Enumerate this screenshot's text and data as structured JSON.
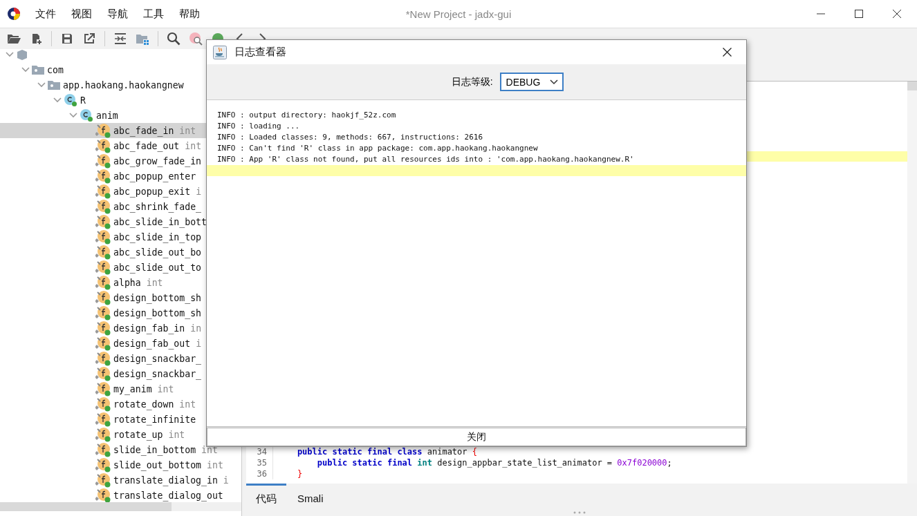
{
  "window": {
    "title": "*New Project - jadx-gui"
  },
  "menu": [
    "文件",
    "视图",
    "导航",
    "工具",
    "帮助"
  ],
  "tree": [
    {
      "kind": "root",
      "expanded": true,
      "selected": false,
      "children": [
        {
          "kind": "package",
          "name": "com",
          "expanded": true,
          "selected": false,
          "children": [
            {
              "kind": "package",
              "name": "app.haokang.haokangnew",
              "expanded": true,
              "selected": false,
              "children": [
                {
                  "kind": "class",
                  "name": "R",
                  "expanded": true,
                  "selected": false,
                  "children": [
                    {
                      "kind": "class",
                      "name": "anim",
                      "expanded": true,
                      "selected": false,
                      "children": [
                        {
                          "kind": "field",
                          "name": "abc_fade_in",
                          "type": "int",
                          "selected": true
                        },
                        {
                          "kind": "field",
                          "name": "abc_fade_out",
                          "type": "int",
                          "selected": false
                        },
                        {
                          "kind": "field",
                          "name": "abc_grow_fade_in",
                          "selected": false
                        },
                        {
                          "kind": "field",
                          "name": "abc_popup_enter",
                          "selected": false
                        },
                        {
                          "kind": "field",
                          "name": "abc_popup_exit",
                          "type": "i",
                          "selected": false
                        },
                        {
                          "kind": "field",
                          "name": "abc_shrink_fade_",
                          "selected": false
                        },
                        {
                          "kind": "field",
                          "name": "abc_slide_in_bott",
                          "selected": false
                        },
                        {
                          "kind": "field",
                          "name": "abc_slide_in_top",
                          "selected": false
                        },
                        {
                          "kind": "field",
                          "name": "abc_slide_out_bo",
                          "selected": false
                        },
                        {
                          "kind": "field",
                          "name": "abc_slide_out_to",
                          "selected": false
                        },
                        {
                          "kind": "field",
                          "name": "alpha",
                          "type": "int",
                          "selected": false
                        },
                        {
                          "kind": "field",
                          "name": "design_bottom_sh",
                          "selected": false
                        },
                        {
                          "kind": "field",
                          "name": "design_bottom_sh",
                          "selected": false
                        },
                        {
                          "kind": "field",
                          "name": "design_fab_in",
                          "type": "in",
                          "selected": false
                        },
                        {
                          "kind": "field",
                          "name": "design_fab_out",
                          "type": "i",
                          "selected": false
                        },
                        {
                          "kind": "field",
                          "name": "design_snackbar_",
                          "selected": false
                        },
                        {
                          "kind": "field",
                          "name": "design_snackbar_",
                          "selected": false
                        },
                        {
                          "kind": "field",
                          "name": "my_anim",
                          "type": "int",
                          "selected": false
                        },
                        {
                          "kind": "field",
                          "name": "rotate_down",
                          "type": "int",
                          "selected": false
                        },
                        {
                          "kind": "field",
                          "name": "rotate_infinite",
                          "selected": false
                        },
                        {
                          "kind": "field",
                          "name": "rotate_up",
                          "type": "int",
                          "selected": false
                        },
                        {
                          "kind": "field",
                          "name": "slide_in_bottom",
                          "type": "int",
                          "selected": false
                        },
                        {
                          "kind": "field",
                          "name": "slide_out_bottom",
                          "type": "int",
                          "selected": false
                        },
                        {
                          "kind": "field",
                          "name": "translate_dialog_in",
                          "type": "i",
                          "selected": false
                        },
                        {
                          "kind": "field",
                          "name": "translate_dialog_out",
                          "selected": false
                        }
                      ]
                    }
                  ]
                }
              ]
            }
          ]
        }
      ]
    }
  ],
  "editor": {
    "lines": [
      {
        "number": "34",
        "tokens": [
          {
            "kind": "keyword",
            "text": "    public static final class"
          },
          {
            "kind": "plain",
            "text": " animator "
          },
          {
            "kind": "brace",
            "text": "{"
          }
        ]
      },
      {
        "number": "35",
        "tokens": [
          {
            "kind": "keyword",
            "text": "        public static final "
          },
          {
            "kind": "type",
            "text": "int"
          },
          {
            "kind": "plain",
            "text": " design_appbar_state_list_animator = "
          },
          {
            "kind": "number",
            "text": "0x7f020000"
          },
          {
            "kind": "plain",
            "text": ";"
          }
        ]
      },
      {
        "number": "36",
        "tokens": [
          {
            "kind": "brace",
            "text": "    }"
          }
        ]
      }
    ]
  },
  "bottom_tabs": [
    {
      "label": "代码",
      "selected": true
    },
    {
      "label": "Smali",
      "selected": false
    }
  ],
  "dialog": {
    "title": "日志查看器",
    "level_label": "日志等级:",
    "level_value": "DEBUG",
    "log": [
      "INFO : output directory: haokjf_52z.com",
      "INFO : loading ...",
      "INFO : Loaded classes: 9, methods: 667, instructions: 2616",
      "INFO : Can't find 'R' class in app package: com.app.haokang.haokangnew",
      "INFO : App 'R' class not found, put all resources ids into : 'com.app.haokang.haokangnew.R'"
    ],
    "button": "关闭"
  }
}
